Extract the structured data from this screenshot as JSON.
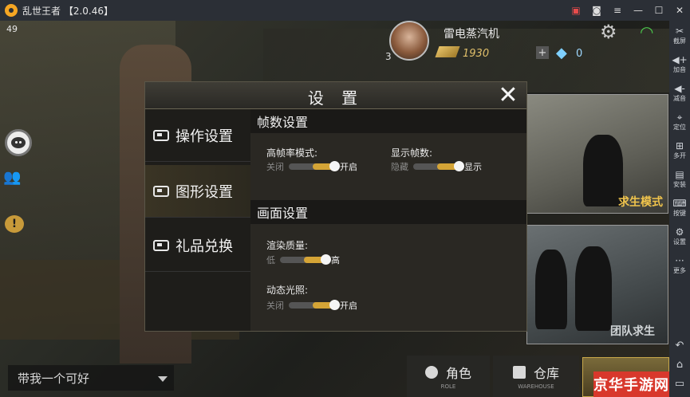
{
  "window": {
    "title": "乱世王者 【2.0.46】"
  },
  "titlebar_icons": [
    "gift-icon",
    "gamepad-icon",
    "menu-icon",
    "minimize-icon",
    "maximize-icon",
    "close-icon"
  ],
  "sidebar": {
    "items": [
      {
        "label": "截屏",
        "icon": "scissors-icon"
      },
      {
        "label": "加音",
        "icon": "volume-up-icon"
      },
      {
        "label": "减音",
        "icon": "volume-down-icon"
      },
      {
        "label": "定位",
        "icon": "location-icon"
      },
      {
        "label": "多开",
        "icon": "multi-window-icon"
      },
      {
        "label": "安装",
        "icon": "apk-icon"
      },
      {
        "label": "按键",
        "icon": "keyboard-icon"
      },
      {
        "label": "设置",
        "icon": "gear-icon"
      },
      {
        "label": "更多",
        "icon": "more-icon"
      }
    ]
  },
  "hud": {
    "fps": "49",
    "player_level": "3",
    "player_name": "雷电蒸汽机",
    "gold": "1930",
    "gems": "0"
  },
  "modes": {
    "survival": "求生模式",
    "team_survival": "团队求生"
  },
  "settings": {
    "title": "设 置",
    "close_symbol": "✕",
    "nav": [
      {
        "label": "操作设置",
        "active": false
      },
      {
        "label": "图形设置",
        "active": true
      },
      {
        "label": "礼品兑换",
        "active": false
      }
    ],
    "frame_section": {
      "heading": "帧数设置",
      "high_fps": {
        "label": "高帧率模式:",
        "off": "关闭",
        "on": "开启",
        "value": "开启"
      },
      "show_fps": {
        "label": "显示帧数:",
        "off": "隐藏",
        "on": "显示",
        "value": "显示"
      }
    },
    "screen_section": {
      "heading": "画面设置",
      "render_quality": {
        "label": "渲染质量:",
        "low": "低",
        "high": "高",
        "value": "高"
      },
      "dynamic_light": {
        "label": "动态光照:",
        "off": "关闭",
        "on": "开启",
        "value": "开启"
      }
    }
  },
  "bottom": {
    "chat_text": "带我一个可好",
    "role_label": "角色",
    "role_sub": "ROLE",
    "warehouse_label": "仓库",
    "warehouse_sub": "WAREHOUSE",
    "watermark": "京华手游网"
  },
  "colors": {
    "accent_gold": "#d4a436",
    "wifi_green": "#4cc94c",
    "watermark_red": "#d8382c"
  }
}
